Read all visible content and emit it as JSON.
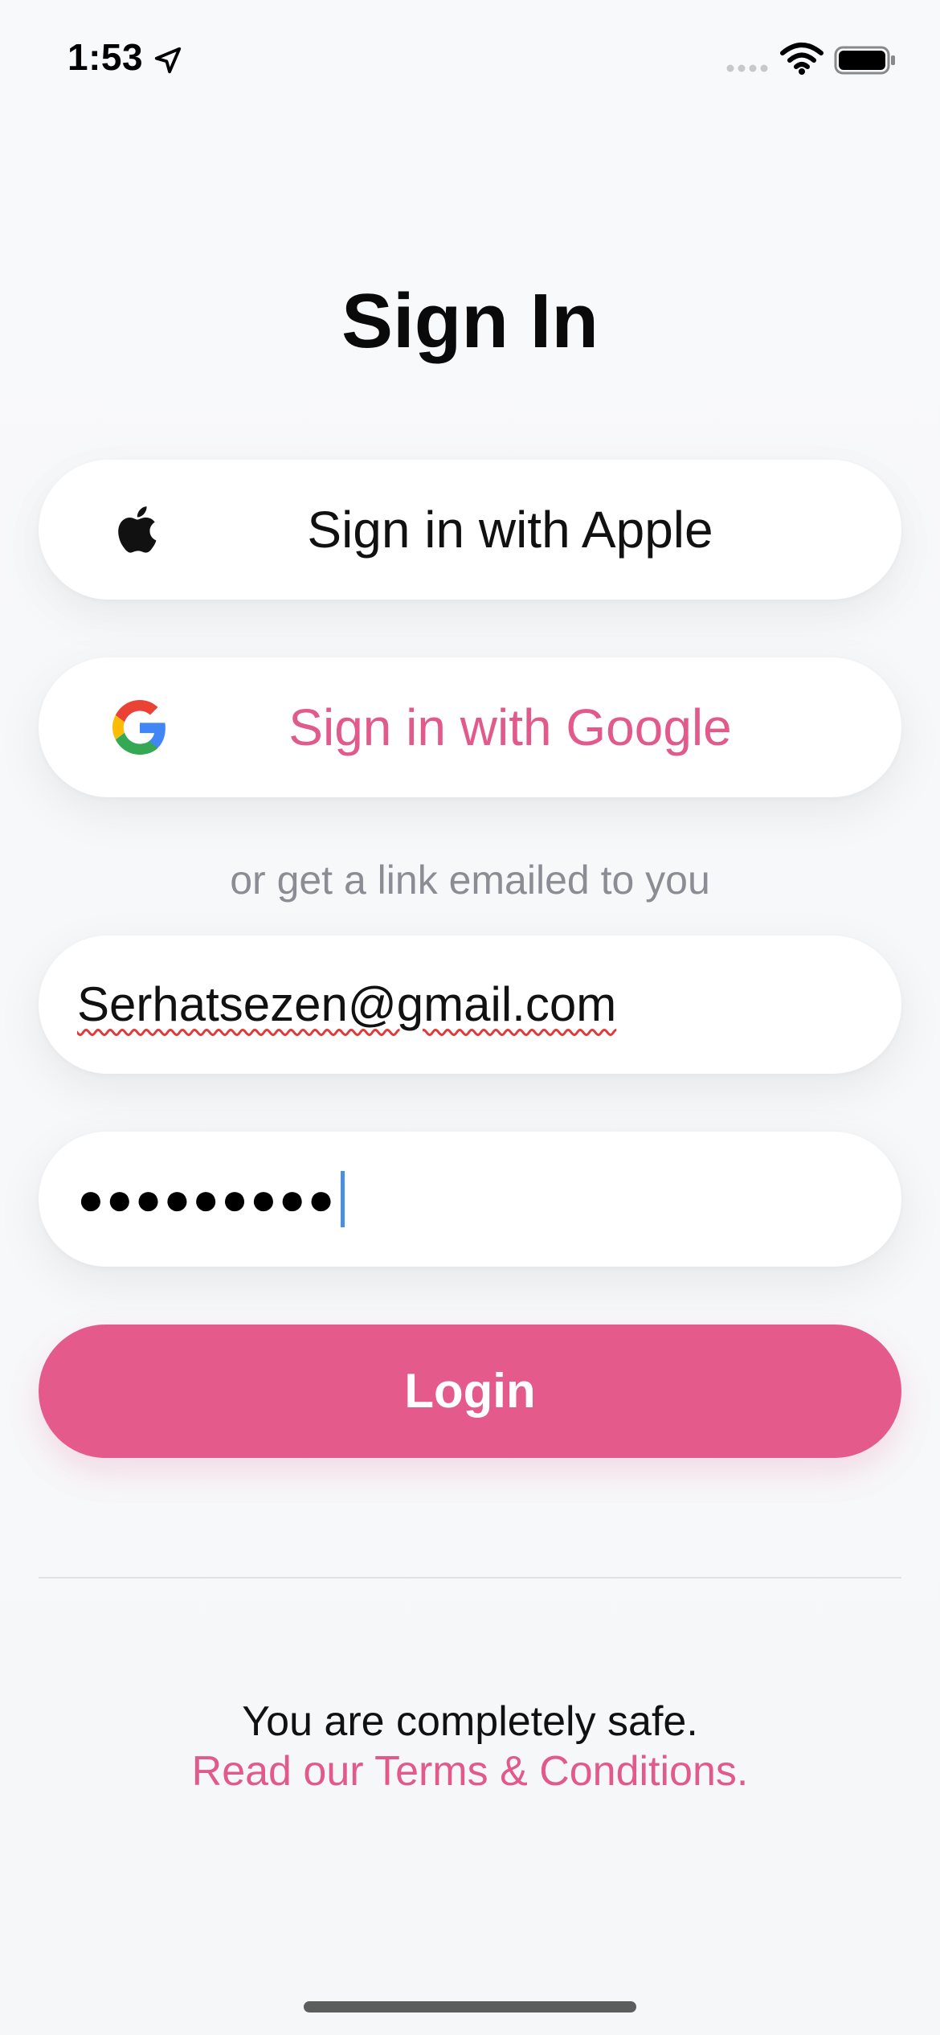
{
  "status_bar": {
    "time": "1:53"
  },
  "title": "Sign In",
  "auth": {
    "apple_label": "Sign in with Apple",
    "google_label": "Sign in with Google",
    "divider_text": "or get a link emailed to you"
  },
  "form": {
    "email_value": "Serhatsezen@gmail.com",
    "password_masked": "●●●●●●●●●",
    "login_label": "Login"
  },
  "footer": {
    "safe_text": "You are completely safe.",
    "terms_link": "Read our Terms & Conditions."
  },
  "colors": {
    "accent": "#e45a8b",
    "background": "#f7f8fa",
    "muted_text": "#8a8d93"
  },
  "icons": {
    "apple": "apple-logo-icon",
    "google": "google-logo-icon",
    "location": "location-arrow-icon",
    "signal": "cellular-signal-icon",
    "wifi": "wifi-icon",
    "battery": "battery-icon"
  }
}
